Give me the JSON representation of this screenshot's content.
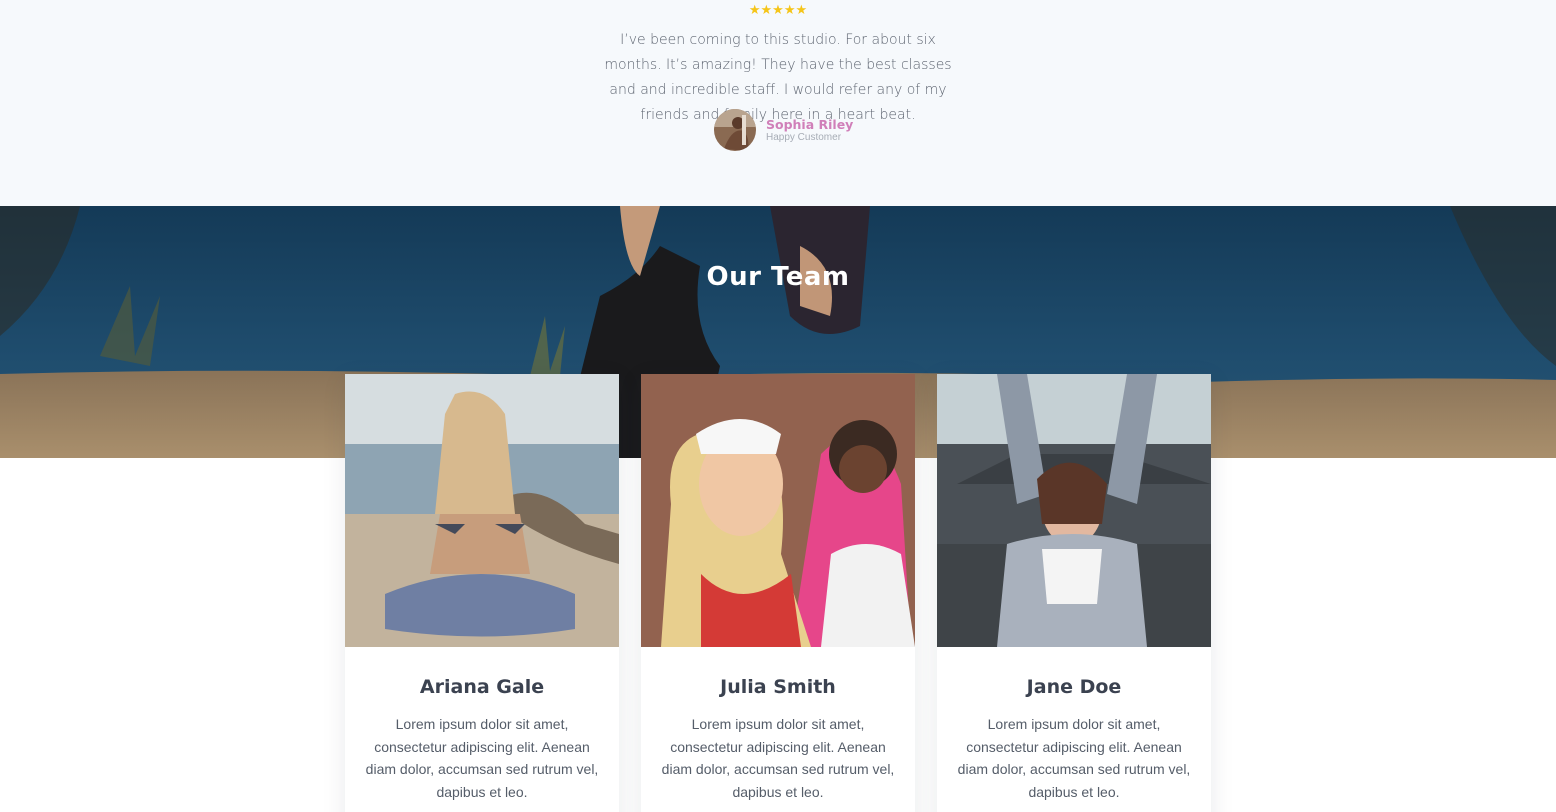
{
  "testimonial": {
    "stars": "★★★★★",
    "rating": 5,
    "quote": "I’ve been coming to this studio. For about six months. It’s amazing! They have the best classes and and incredible staff. I would refer any of my friends and family here in a heart beat.",
    "author_name": "Sophia Riley",
    "author_role": "Happy Customer"
  },
  "team": {
    "title": "Our Team",
    "members": [
      {
        "name": "Ariana Gale",
        "bio": "Lorem ipsum dolor sit amet, consectetur adipiscing elit. Aenean diam dolor, accumsan sed rutrum vel, dapibus et leo."
      },
      {
        "name": "Julia Smith",
        "bio": "Lorem ipsum dolor sit amet, consectetur adipiscing elit. Aenean diam dolor, accumsan sed rutrum vel, dapibus et leo."
      },
      {
        "name": "Jane Doe",
        "bio": "Lorem ipsum dolor sit amet, consectetur adipiscing elit. Aenean diam dolor, accumsan sed rutrum vel, dapibus et leo."
      }
    ]
  },
  "colors": {
    "accent_pink": "#d07fb9",
    "star_gold": "#f5c518",
    "heading": "#3b4250",
    "body_text": "#555d69"
  }
}
